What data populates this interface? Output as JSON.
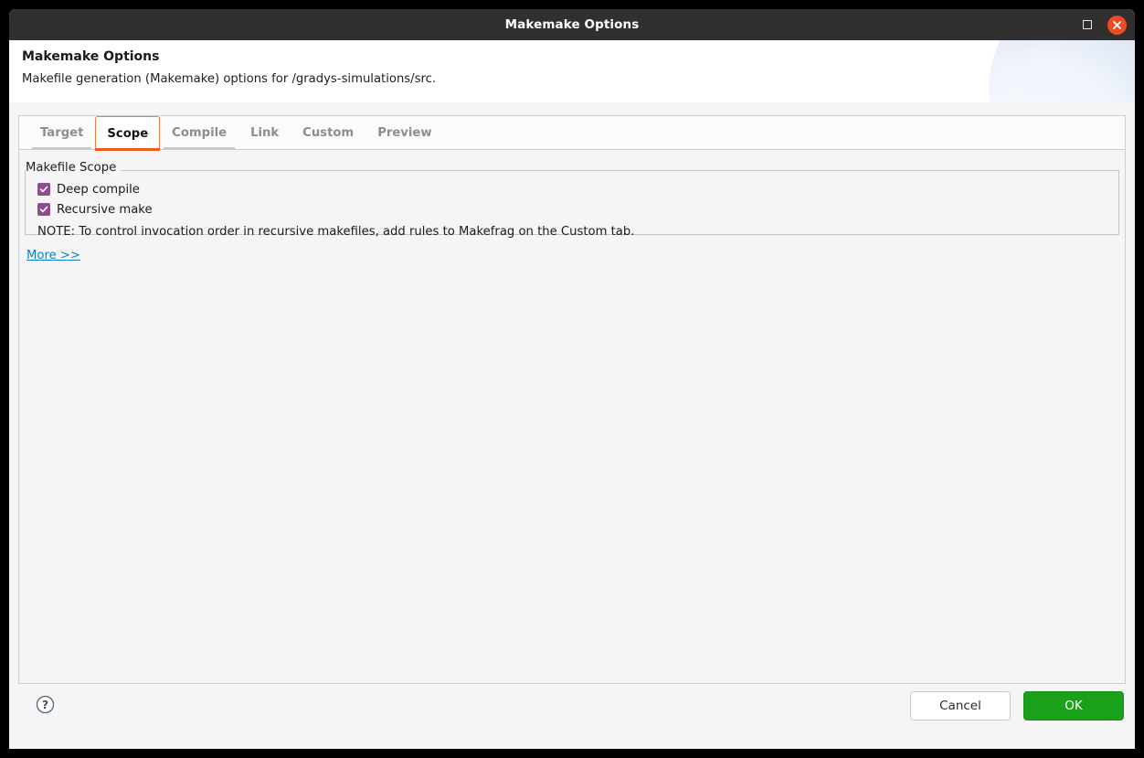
{
  "window": {
    "title": "Makemake Options",
    "controls": {
      "maximize_label": "Maximize",
      "close_label": "Close"
    }
  },
  "banner": {
    "title": "Makemake Options",
    "subtitle": "Makefile generation (Makemake) options for /gradys-simulations/src."
  },
  "tabs": [
    {
      "label": "Target",
      "selected": false
    },
    {
      "label": "Scope",
      "selected": true
    },
    {
      "label": "Compile",
      "selected": false
    },
    {
      "label": "Link",
      "selected": false
    },
    {
      "label": "Custom",
      "selected": false
    },
    {
      "label": "Preview",
      "selected": false
    }
  ],
  "scope_tab": {
    "group_title": "Makefile Scope",
    "checkboxes": [
      {
        "label": "Deep compile",
        "checked": true
      },
      {
        "label": "Recursive make",
        "checked": true
      }
    ],
    "note": "NOTE: To control invocation order in recursive makefiles, add rules to Makefrag on the Custom tab.",
    "more_link": "More >>"
  },
  "footer": {
    "help_label": "?",
    "cancel_label": "Cancel",
    "ok_label": "OK"
  },
  "colors": {
    "titlebar_bg": "#303030",
    "close_button": "#f04a22",
    "tab_accent": "#ef5a20",
    "checkbox": "#8e4e8e",
    "link": "#0e80c1",
    "ok_button": "#1aa01a"
  }
}
